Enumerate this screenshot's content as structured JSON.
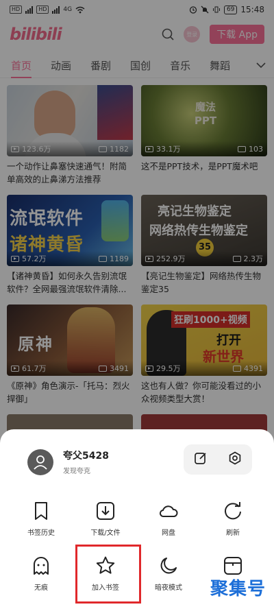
{
  "status_bar": {
    "sim1": "HD",
    "sim2": "HD",
    "network": "4G",
    "battery": "69",
    "time": "15:48"
  },
  "header": {
    "logo": "bilibili",
    "login_label": "登录",
    "download_label": "下载 App"
  },
  "tabs": [
    {
      "label": "首页",
      "active": true
    },
    {
      "label": "动画"
    },
    {
      "label": "番剧"
    },
    {
      "label": "国创"
    },
    {
      "label": "音乐"
    },
    {
      "label": "舞蹈"
    }
  ],
  "videos": [
    {
      "views": "123.6万",
      "danmaku": "1182",
      "title": "一个动作让鼻塞快速通气！附简单高效的止鼻涕方法推荐"
    },
    {
      "views": "33.1万",
      "danmaku": "103",
      "title": "这不是PPT技术，是PPT魔术吧",
      "overlay": "魔法\nPPT"
    },
    {
      "views": "57.2万",
      "danmaku": "1189",
      "title": "【诸神黄昏】如何永久告别流氓软件？全网最强流氓软件清除...",
      "overlay_top": "流氓软件",
      "overlay_bottom": "诸神黄昏"
    },
    {
      "views": "252.9万",
      "danmaku": "2.3万",
      "title": "【亮记生物鉴定】网络热传生物鉴定35",
      "overlay_top": "亮记生物鉴定",
      "overlay_bottom": "网络热传生物鉴定",
      "badge": "35"
    },
    {
      "views": "61.7万",
      "danmaku": "3491",
      "title": "《原神》角色演示-「托马：烈火捍御」",
      "overlay": "原神"
    },
    {
      "views": "29.5万",
      "danmaku": "4391",
      "title": "这也有人做？你可能没看过的小众视频类型大赏！",
      "overlay_top": "狂刷1000+视频",
      "overlay_mid": "打开",
      "overlay_bottom": "新世界"
    }
  ],
  "sheet": {
    "profile_name": "夸父5428",
    "profile_sub": "发现夸克",
    "actions": [
      {
        "label": "书签历史",
        "icon": "bookmark-icon"
      },
      {
        "label": "下载/文件",
        "icon": "download-icon"
      },
      {
        "label": "网盘",
        "icon": "cloud-icon"
      },
      {
        "label": "刷新",
        "icon": "refresh-icon"
      },
      {
        "label": "无痕",
        "icon": "ghost-icon"
      },
      {
        "label": "加入书签",
        "icon": "star-icon"
      },
      {
        "label": "暗夜模式",
        "icon": "moon-icon"
      },
      {
        "label": "",
        "icon": "window-icon"
      }
    ]
  },
  "watermark": "聚集号",
  "colors": {
    "brand_pink": "#fb7299",
    "highlight_red": "#e0282b"
  }
}
